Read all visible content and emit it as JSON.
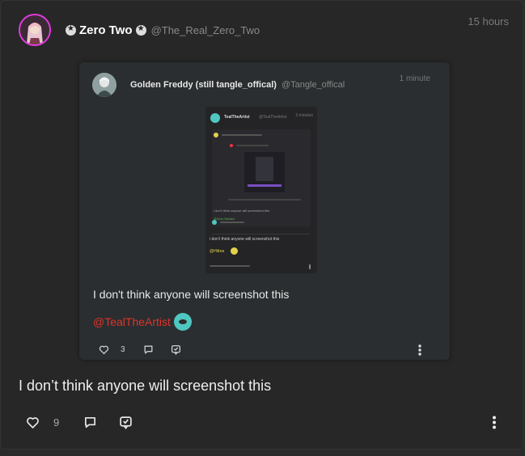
{
  "post": {
    "display_name": "Zero Two",
    "handle": "@The_Real_Zero_Two",
    "time": "15 hours",
    "text": "I don’t think anyone will screenshot this",
    "like_count": "9"
  },
  "embed": {
    "display_name": "Golden Freddy (still tangle_offical)",
    "handle": "@Tangle_offical",
    "time": "1 minute",
    "text": "I don't think anyone will screenshot this",
    "mention": "@TealTheArtist",
    "like_count": "3",
    "screenshot": {
      "name": "TealTheArtist",
      "handle": "@TealTheArtist",
      "time": "3 minutes",
      "inner_line1": "i don't think anyone will screenshot this",
      "inner_mention1": "@Zero Hidden",
      "inner_line2": "i don't think anyone will screenshot this",
      "inner_mention2": "@Hittea"
    }
  },
  "colors": {
    "background": "#272727",
    "mention": "#e0322b",
    "avatar_ring": "#e33be0"
  },
  "icons": [
    "heart-icon",
    "comment-icon",
    "quote-icon",
    "more-icon",
    "badge-icon"
  ]
}
